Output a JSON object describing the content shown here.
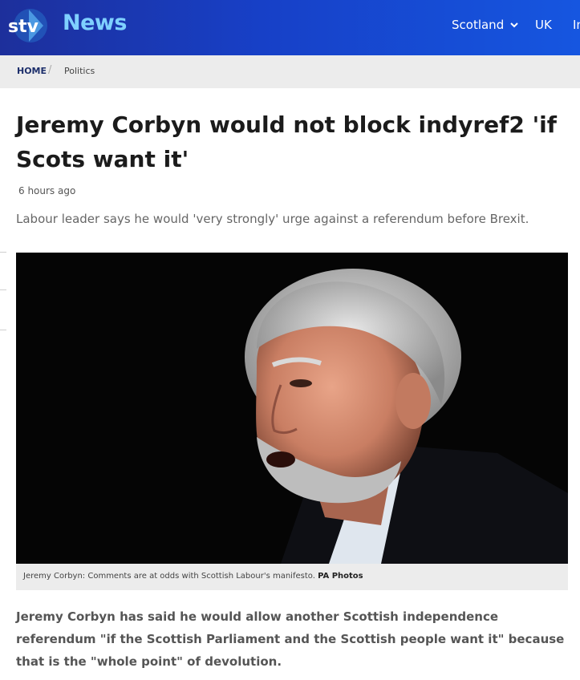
{
  "header": {
    "logo_text": "stv",
    "brand": "News",
    "nav": [
      {
        "label": "Scotland"
      },
      {
        "label": "UK"
      },
      {
        "label": "In"
      }
    ]
  },
  "breadcrumb": {
    "home": "HOME",
    "separator": "/",
    "current": "Politics"
  },
  "article": {
    "headline": "Jeremy Corbyn would not block indyref2 'if Scots want it'",
    "timestamp": "6 hours ago",
    "standfirst": "Labour leader says he would 'very strongly' urge against a referendum before Brexit.",
    "image_caption": "Jeremy Corbyn: Comments are at odds with Scottish Labour's manifesto.",
    "image_credit": "PA Photos",
    "lead": "Jeremy Corbyn has said he would allow another Scottish independence referendum \"if the Scottish Parliament and the Scottish people want it\" because that is the \"whole point\" of devolution."
  },
  "colors": {
    "header_gradient_start": "#1d2f9b",
    "header_gradient_end": "#1656e0",
    "brand_news": "#7fd0ff",
    "breadcrumb_bg": "#ececec"
  }
}
